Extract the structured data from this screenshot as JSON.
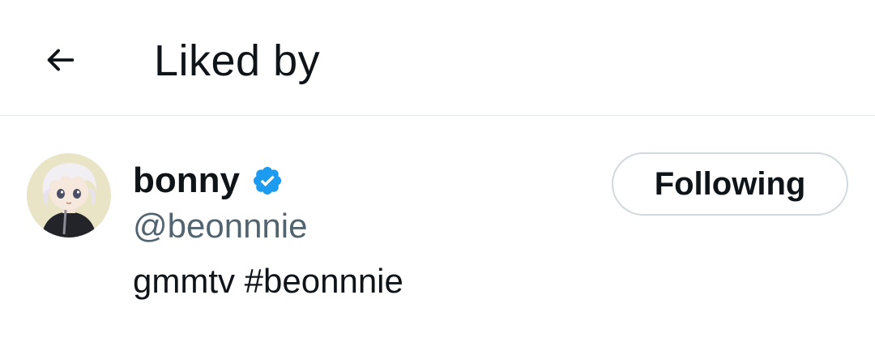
{
  "header": {
    "title": "Liked by",
    "back_icon": "arrow-left-icon"
  },
  "users": [
    {
      "display_name": "bonny",
      "verified": true,
      "verified_icon": "verified-badge-icon",
      "verified_color": "#1d9bf0",
      "handle": "@beonnnie",
      "bio": "gmmtv #beonnnie",
      "follow_button_label": "Following"
    }
  ],
  "colors": {
    "text_primary": "#0f1419",
    "text_secondary": "#536471",
    "divider": "#e6e9eb",
    "button_border": "#cfd9de"
  }
}
